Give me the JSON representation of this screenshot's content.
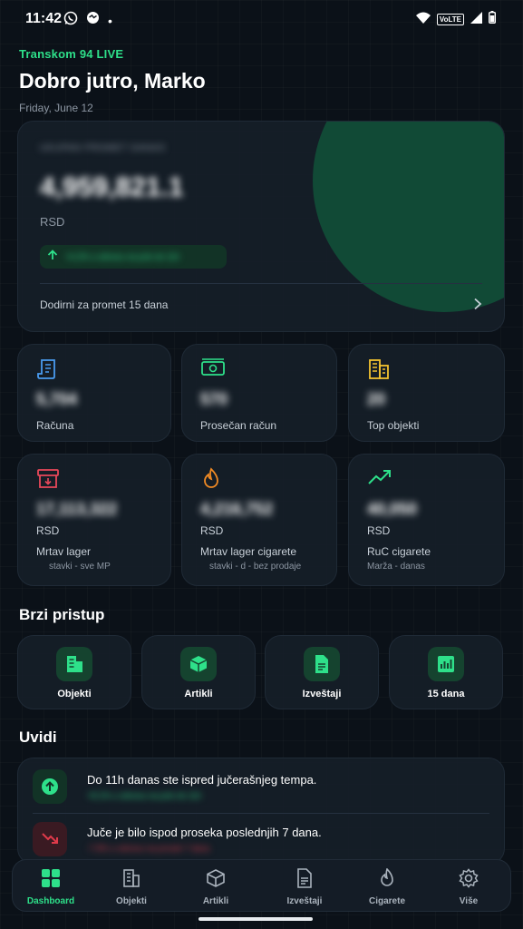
{
  "status_bar": {
    "time": "11:42",
    "volte": "VoLTE",
    "dot": "•"
  },
  "header": {
    "store": "Transkom 94 LIVE",
    "greeting": "Dobro jutro, Marko",
    "date": "Friday, June 12"
  },
  "hero": {
    "label": "UKUPAN PROMET DANAS",
    "value": "4,959,821.1",
    "currency": "RSD",
    "change": "+6.2% u odnosu na juče do 11h",
    "footer": "Dodirni za promet 15 dana"
  },
  "tiles_row1": [
    {
      "value": "5,704",
      "label": "Računa",
      "icon": "receipt-icon"
    },
    {
      "value": "570",
      "label": "Prosečan račun",
      "icon": "cash-icon"
    },
    {
      "value": "20",
      "label": "Top objekti",
      "icon": "buildings-icon"
    }
  ],
  "tiles_row2": [
    {
      "value": "17,113,322",
      "unit": "RSD",
      "label": "Mrtav lager",
      "sub": "stavki - sve MP",
      "icon": "archive-icon"
    },
    {
      "value": "4,216,752",
      "unit": "RSD",
      "label": "Mrtav lager cigarete",
      "sub": "stavki - d - bez prodaje",
      "icon": "flame-icon"
    },
    {
      "value": "40,050",
      "unit": "RSD",
      "label": "RuC cigarete",
      "sub": "Marža - danas",
      "icon": "trend-up-icon"
    }
  ],
  "quick_access": {
    "title": "Brzi pristup",
    "items": [
      {
        "label": "Objekti",
        "icon": "building-icon"
      },
      {
        "label": "Artikli",
        "icon": "box-icon"
      },
      {
        "label": "Izveštaji",
        "icon": "document-icon"
      },
      {
        "label": "15 dana",
        "icon": "bar-chart-icon"
      }
    ]
  },
  "insights": {
    "title": "Uvidi",
    "items": [
      {
        "title": "Do 11h danas ste ispred jučerašnjeg tempa.",
        "sub": "+8.1% u odnosu na juče do 11h",
        "tone": "positive",
        "color": "#2ee08a"
      },
      {
        "title": "Juče je bilo ispod proseka poslednjih 7 dana.",
        "sub": "-7.8% u odnosu na prosek 7 dana",
        "tone": "negative",
        "color": "#e03a4a"
      }
    ]
  },
  "bottom_nav": {
    "active": "Dashboard",
    "items": [
      {
        "label": "Dashboard",
        "icon": "grid-icon"
      },
      {
        "label": "Objekti",
        "icon": "building-icon"
      },
      {
        "label": "Artikli",
        "icon": "cube-icon"
      },
      {
        "label": "Izveštaji",
        "icon": "document-icon"
      },
      {
        "label": "Cigarete",
        "icon": "flame-icon"
      },
      {
        "label": "Više",
        "icon": "gear-icon"
      }
    ]
  },
  "colors": {
    "accent": "#2ee08a",
    "background": "#0b1118",
    "card": "#161e28",
    "negative": "#e03a4a",
    "muted": "#8d97a3"
  }
}
